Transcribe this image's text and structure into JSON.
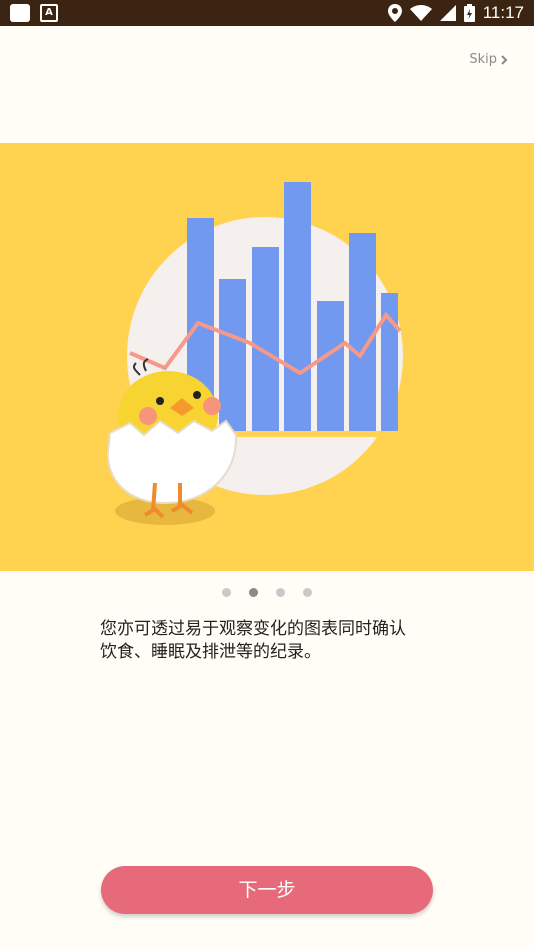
{
  "status_bar": {
    "time": "11:17",
    "app_icon_letter": "A"
  },
  "skip_label": "Skip",
  "onboarding": {
    "description_line1": "您亦可透过易于观察变化的图表同时确认",
    "description_line2": "饮食、睡眠及排泄等的纪录。",
    "page_count": 4,
    "active_page": 2
  },
  "next_button_label": "下一步",
  "colors": {
    "banner": "#ffd24f",
    "button": "#e76a7a",
    "bars": "#7199ef",
    "line": "#f59a8b"
  }
}
